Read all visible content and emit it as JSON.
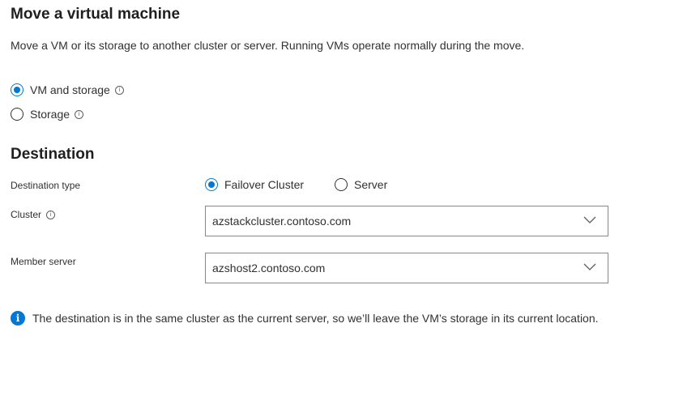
{
  "page": {
    "title": "Move a virtual machine",
    "description": "Move a VM or its storage to another cluster or server. Running VMs operate normally during the move."
  },
  "move_type": {
    "options": [
      {
        "label": "VM and storage",
        "checked": true,
        "info_icon": "info-icon"
      },
      {
        "label": "Storage",
        "checked": false,
        "info_icon": "info-icon"
      }
    ]
  },
  "destination": {
    "section_title": "Destination",
    "type_label": "Destination type",
    "type_options": [
      {
        "label": "Failover Cluster",
        "checked": true
      },
      {
        "label": "Server",
        "checked": false
      }
    ],
    "cluster_label": "Cluster",
    "cluster_value": "azstackcluster.contoso.com",
    "member_server_label": "Member server",
    "member_server_value": "azshost2.contoso.com"
  },
  "info_message": {
    "icon": "info-filled-icon",
    "text": "The destination is in the same cluster as the current server, so we’ll leave the VM’s storage in its current location.",
    "icon_color": "#0078d4"
  },
  "colors": {
    "accent": "#0078d4",
    "text": "#323130",
    "border": "#8a8886"
  }
}
